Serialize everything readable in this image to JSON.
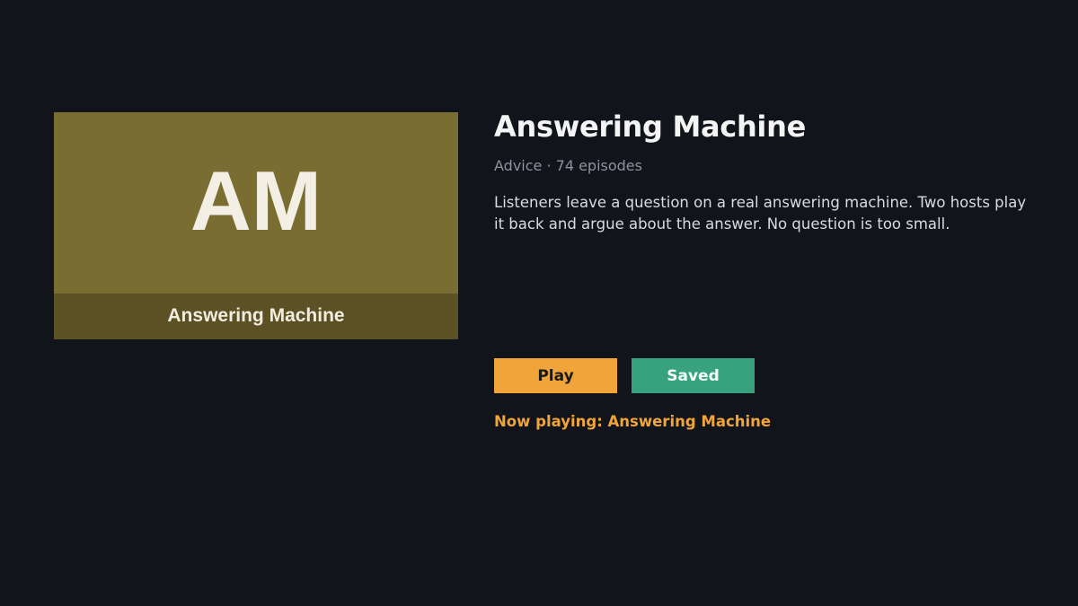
{
  "podcast": {
    "artwork": {
      "initials": "AM",
      "caption": "Answering Machine",
      "color": "#7a6d32"
    },
    "title": "Answering Machine",
    "meta": "Advice · 74 episodes",
    "description": "Listeners leave a question on a real answering machine. Two hosts play it back and argue about the answer. No question is too small."
  },
  "actions": {
    "play_label": "Play",
    "saved_label": "Saved"
  },
  "status": {
    "now_playing": "Now playing: Answering Machine"
  },
  "colors": {
    "background": "#11141b",
    "accent": "#f0a43a",
    "saved": "#37a27d"
  }
}
